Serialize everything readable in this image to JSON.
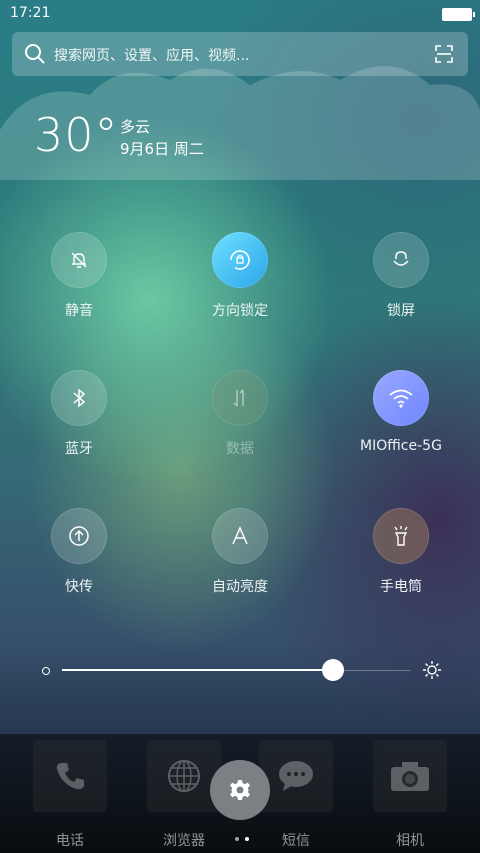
{
  "status_bar": {
    "time": "17:21"
  },
  "search": {
    "placeholder": "搜索网页、设置、应用、视频..."
  },
  "weather": {
    "temperature": "30°",
    "condition": "多云",
    "date": "9月6日 周二"
  },
  "toggles": [
    {
      "label": "静音",
      "icon": "bell-off-icon",
      "state": "off"
    },
    {
      "label": "方向锁定",
      "icon": "rotation-lock-icon",
      "state": "on"
    },
    {
      "label": "锁屏",
      "icon": "lock-icon",
      "state": "off"
    },
    {
      "label": "蓝牙",
      "icon": "bluetooth-icon",
      "state": "off"
    },
    {
      "label": "数据",
      "icon": "mobile-data-icon",
      "state": "disabled"
    },
    {
      "label": "MIOffice-5G",
      "icon": "wifi-icon",
      "state": "on"
    },
    {
      "label": "快传",
      "icon": "share-icon",
      "state": "off"
    },
    {
      "label": "自动亮度",
      "icon": "auto-brightness-icon",
      "state": "off"
    },
    {
      "label": "手电筒",
      "icon": "flashlight-icon",
      "state": "off"
    }
  ],
  "brightness": {
    "level": 0.78
  },
  "dock": [
    {
      "label": "电话",
      "icon": "phone-icon"
    },
    {
      "label": "浏览器",
      "icon": "browser-icon"
    },
    {
      "label": "短信",
      "icon": "message-icon"
    },
    {
      "label": "相机",
      "icon": "camera-icon"
    }
  ],
  "colors": {
    "accent_blue": "#3fb8f2",
    "accent_purple": "#8596ff"
  }
}
